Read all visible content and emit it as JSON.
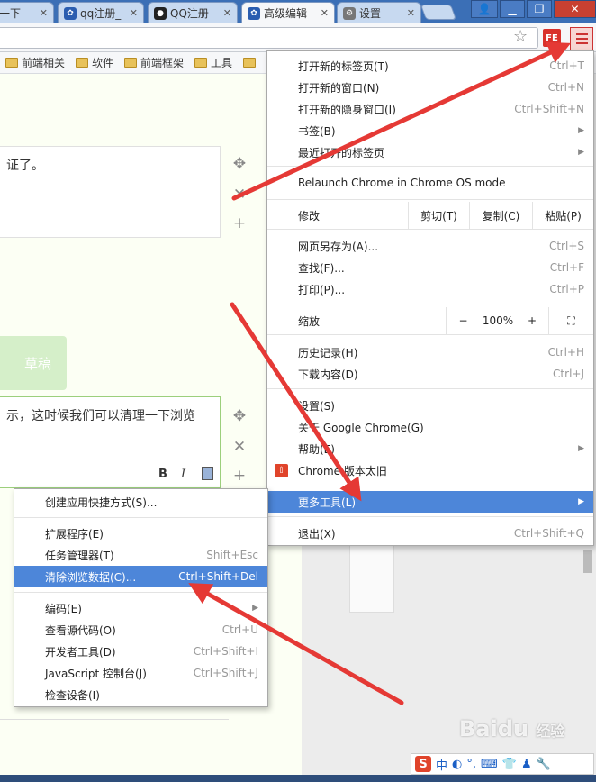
{
  "tabs": [
    {
      "label": "一下",
      "icon": "close-icon"
    },
    {
      "label": "qq注册_",
      "icon": "baidu-paw-icon"
    },
    {
      "label": "QQ注册",
      "icon": "qq-penguin-icon"
    },
    {
      "label": "高级编辑",
      "icon": "baidu-paw-icon"
    },
    {
      "label": "设置",
      "icon": "gear-icon"
    }
  ],
  "toolbar": {
    "ext_label": "FE"
  },
  "bookmarks": [
    "前端相关",
    "软件",
    "前端框架",
    "工具"
  ],
  "page": {
    "text1": "证了。",
    "text2": "示，这时候我们可以清理一下浏览",
    "draft": "草稿",
    "bold": "B",
    "italic": "I"
  },
  "chrome_menu": {
    "items_top": [
      {
        "label": "打开新的标签页(T)",
        "shortcut": "Ctrl+T"
      },
      {
        "label": "打开新的窗口(N)",
        "shortcut": "Ctrl+N"
      },
      {
        "label": "打开新的隐身窗口(I)",
        "shortcut": "Ctrl+Shift+N"
      },
      {
        "label": "书签(B)",
        "shortcut": ""
      },
      {
        "label": "最近打开的标签页",
        "shortcut": ""
      }
    ],
    "relaunch": "Relaunch Chrome in Chrome OS mode",
    "edit": {
      "label": "修改",
      "cut": "剪切(T)",
      "copy": "复制(C)",
      "paste": "粘贴(P)"
    },
    "items_mid": [
      {
        "label": "网页另存为(A)...",
        "shortcut": "Ctrl+S"
      },
      {
        "label": "查找(F)...",
        "shortcut": "Ctrl+F"
      },
      {
        "label": "打印(P)...",
        "shortcut": "Ctrl+P"
      }
    ],
    "zoom": {
      "label": "缩放",
      "minus": "−",
      "value": "100%",
      "plus": "+"
    },
    "items_hist": [
      {
        "label": "历史记录(H)",
        "shortcut": "Ctrl+H"
      },
      {
        "label": "下载内容(D)",
        "shortcut": "Ctrl+J"
      }
    ],
    "items_settings": [
      {
        "label": "设置(S)"
      },
      {
        "label": "关于 Google Chrome(G)"
      },
      {
        "label": "帮助(E)"
      },
      {
        "label": "Chrome 版本太旧"
      }
    ],
    "more_tools": "更多工具(L)",
    "exit": {
      "label": "退出(X)",
      "shortcut": "Ctrl+Shift+Q"
    }
  },
  "more_tools_menu": {
    "create_shortcut": "创建应用快捷方式(S)...",
    "extensions": "扩展程序(E)",
    "task_manager": {
      "label": "任务管理器(T)",
      "shortcut": "Shift+Esc"
    },
    "clear_data": {
      "label": "清除浏览数据(C)...",
      "shortcut": "Ctrl+Shift+Del"
    },
    "encoding": "编码(E)",
    "view_source": {
      "label": "查看源代码(O)",
      "shortcut": "Ctrl+U"
    },
    "dev_tools": {
      "label": "开发者工具(D)",
      "shortcut": "Ctrl+Shift+I"
    },
    "js_console": {
      "label": "JavaScript 控制台(J)",
      "shortcut": "Ctrl+Shift+J"
    },
    "inspect": "检查设备(I)"
  },
  "watermark": {
    "text": "Baidu",
    "sub": "经验"
  },
  "ime": {
    "logo": "S",
    "lang": "中"
  },
  "colors": {
    "highlight": "#4d86d9",
    "arrow": "#e53935",
    "draft": "#d5efc9"
  }
}
